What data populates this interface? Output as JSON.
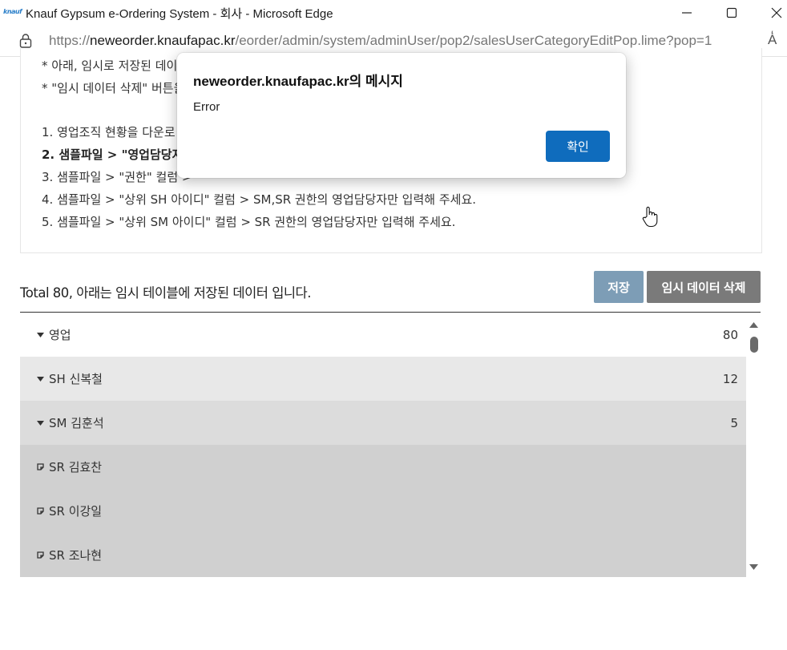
{
  "window": {
    "title": "Knauf Gypsum e-Ordering System - 회사 - Microsoft Edge",
    "logo_text": "knauf"
  },
  "address_bar": {
    "url_prefix": "https://",
    "url_host": "neweorder.knaufapac.kr",
    "url_path": "/eorder/admin/system/adminUser/pop2/salesUserCategoryEditPop.lime?pop=1",
    "read_aloud": "A̒"
  },
  "notice": {
    "lines": [
      "* 아래, 임시로 저장된 데이",
      "* \"임시 데이터 삭제\" 버튼을",
      "1. 영업조직 현황을 다운로",
      "2. 샘플파일 > \"영업담당자",
      "3. 샘플파일 > \"권한\" 컬럼 > ",
      "4. 샘플파일 > \"상위 SH 아이디\" 컬럼 > SM,SR 권한의 영업담당자만 입력해 주세요.",
      "5. 샘플파일 > \"상위 SM 아이디\" 컬럼 > SR 권한의 영업담당자만 입력해 주세요."
    ]
  },
  "summary": "Total 80, 아래는 임시 테이블에 저장된 데이터 입니다.",
  "buttons": {
    "save": "저장",
    "delete_temp": "임시 데이터 삭제"
  },
  "tree": {
    "rows": [
      {
        "label": "영업",
        "count": "80"
      },
      {
        "label": "SH 신복철",
        "count": "12"
      },
      {
        "label": "SM 김훈석",
        "count": "5"
      },
      {
        "label": "SR 김효찬",
        "count": ""
      },
      {
        "label": "SR 이강일",
        "count": ""
      },
      {
        "label": "SR 조나현",
        "count": ""
      }
    ]
  },
  "dialog": {
    "title": "neweorder.knaufapac.kr의 메시지",
    "message": "Error",
    "ok_label": "확인"
  },
  "colors": {
    "dialog_ok": "#0f6cbd",
    "save_button": "#7d9db6",
    "delete_button": "#7a7a7a"
  }
}
